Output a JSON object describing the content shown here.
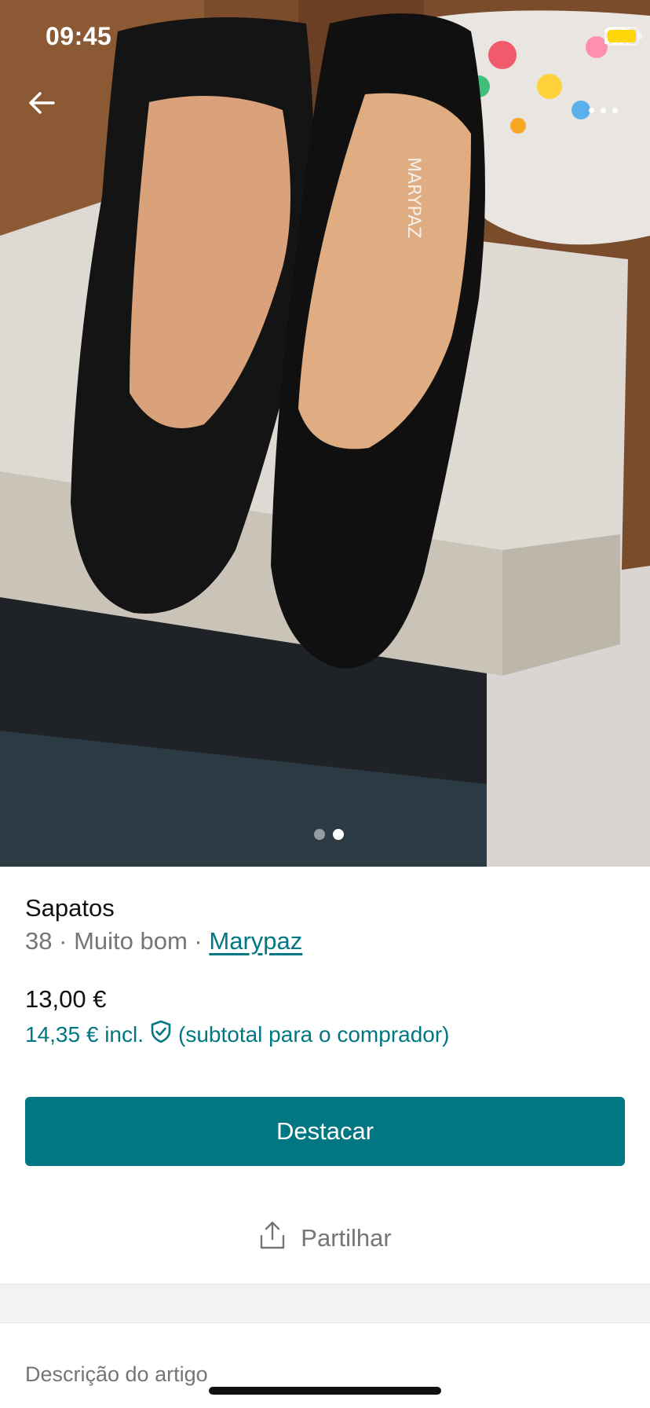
{
  "status_bar": {
    "time": "09:45"
  },
  "gallery": {
    "image_count": 2,
    "active_index": 1
  },
  "item": {
    "title": "Sapatos",
    "size": "38",
    "separator": "·",
    "condition": "Muito bom",
    "brand": "Marypaz",
    "price": "13,00 €",
    "price_incl": "14,35 € incl.",
    "price_incl_note": "(subtotal para o comprador)"
  },
  "actions": {
    "primary_label": "Destacar",
    "share_label": "Partilhar"
  },
  "description": {
    "heading": "Descrição do artigo"
  },
  "colors": {
    "accent": "#007782",
    "muted_text": "#757575",
    "battery": "#FFD60A"
  },
  "icons": [
    "back-arrow-icon",
    "more-options-icon",
    "shield-check-icon",
    "share-icon",
    "signal-icon",
    "wifi-icon",
    "battery-icon"
  ]
}
